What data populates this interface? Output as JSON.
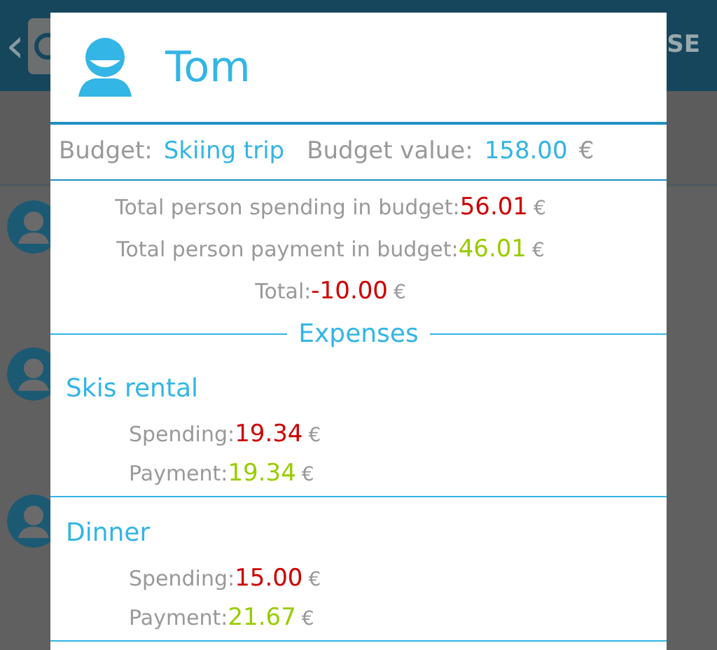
{
  "app_bar": {
    "back": "‹",
    "action": "SE"
  },
  "dialog": {
    "name": "Tom",
    "budget": {
      "label": "Budget:",
      "name": "Skiing trip",
      "value_label": "Budget value:",
      "value": "158.00",
      "currency": "€"
    },
    "totals": [
      {
        "label": "Total person spending in budget:",
        "value": "56.01",
        "currency": "€",
        "kind": "debit"
      },
      {
        "label": "Total person payment in budget:",
        "value": "46.01",
        "currency": "€",
        "kind": "credit"
      },
      {
        "label": "Total:",
        "value": "-10.00",
        "currency": "€",
        "kind": "debit"
      }
    ],
    "section_title": "Expenses",
    "expenses": [
      {
        "title": "Skis rental",
        "lines": [
          {
            "label": "Spending:",
            "value": "19.34",
            "currency": "€",
            "kind": "debit"
          },
          {
            "label": "Payment:",
            "value": "19.34",
            "currency": "€",
            "kind": "credit"
          }
        ]
      },
      {
        "title": "Dinner",
        "lines": [
          {
            "label": "Spending:",
            "value": "15.00",
            "currency": "€",
            "kind": "debit"
          },
          {
            "label": "Payment:",
            "value": "21.67",
            "currency": "€",
            "kind": "credit"
          }
        ]
      }
    ]
  }
}
